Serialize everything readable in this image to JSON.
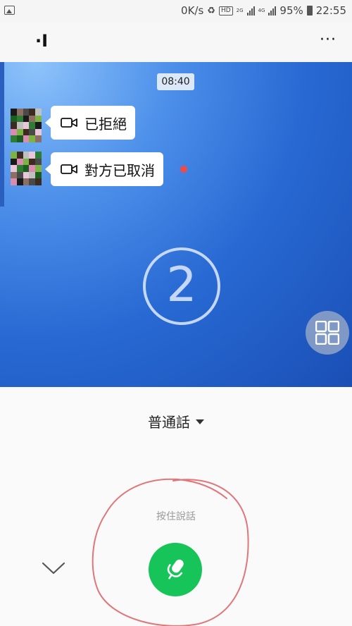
{
  "status_bar": {
    "speed": "0K/s",
    "hd_badge": "HD",
    "sim1_tag": "2G",
    "sim2_tag": "4G",
    "battery": "95%",
    "time": "22:55",
    "icons": [
      "image-icon",
      "recycle-icon",
      "signal-icon",
      "battery-icon"
    ]
  },
  "app_bar": {
    "title": "·I",
    "more_label": "···"
  },
  "chat": {
    "timestamp": "08:40",
    "messages": [
      {
        "text": "已拒絕",
        "icon": "video-camera-icon"
      },
      {
        "text": "對方已取消",
        "icon": "video-camera-icon",
        "unread": true
      }
    ],
    "watermark": "2",
    "accent_color": "#2869d3"
  },
  "voice_input": {
    "language": "普通話",
    "hint": "按住說話",
    "mic_color": "#16c45a"
  }
}
